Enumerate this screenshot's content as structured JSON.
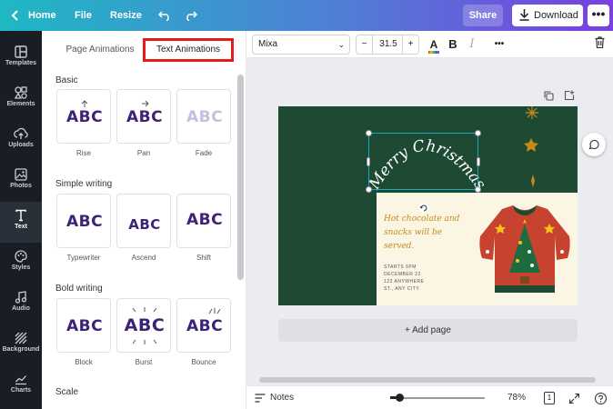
{
  "topbar": {
    "home_label": "Home",
    "file_label": "File",
    "resize_label": "Resize",
    "share_label": "Share",
    "download_label": "Download",
    "more_label": "•••"
  },
  "rail": {
    "items": [
      {
        "label": "Templates",
        "icon": "layout-icon"
      },
      {
        "label": "Elements",
        "icon": "shapes-icon"
      },
      {
        "label": "Uploads",
        "icon": "cloud-upload-icon"
      },
      {
        "label": "Photos",
        "icon": "image-icon"
      },
      {
        "label": "Text",
        "icon": "text-icon"
      },
      {
        "label": "Styles",
        "icon": "palette-icon"
      },
      {
        "label": "Audio",
        "icon": "music-note-icon"
      },
      {
        "label": "Background",
        "icon": "pattern-icon"
      },
      {
        "label": "Charts",
        "icon": "chart-line-icon"
      }
    ],
    "active": "Text"
  },
  "panel": {
    "tabs": {
      "page": "Page Animations",
      "text": "Text Animations"
    },
    "sections": {
      "basic": "Basic",
      "simple": "Simple writing",
      "bold": "Bold writing",
      "scale": "Scale"
    },
    "sample_text": "ABC",
    "cards": {
      "rise": "Rise",
      "pan": "Pan",
      "fade": "Fade",
      "typewriter": "Typewriter",
      "ascend": "Ascend",
      "shift": "Shift",
      "block": "Block",
      "burst": "Burst",
      "bounce": "Bounce"
    }
  },
  "toolbar": {
    "font": "Mixa",
    "font_size": "31.5",
    "minus_label": "−",
    "plus_label": "+",
    "color_label": "A",
    "bold_label": "B",
    "italic_label": "I",
    "more_label": "•••"
  },
  "design": {
    "headline": "Merry Christmas",
    "card_text": "Hot chocolate and snacks will be served.",
    "details": [
      "STARTS 6PM",
      "DECEMBER 22",
      "123 ANYWHERE",
      "ST., ANY CITY"
    ],
    "colors": {
      "background": "#1e4a34",
      "card": "#fbf5e3",
      "accent": "#c98a1a",
      "sweater": "#c7432f"
    }
  },
  "workspace": {
    "add_page_label": "+ Add page"
  },
  "bottombar": {
    "notes_label": "Notes",
    "zoom_level": "78%",
    "page_count": "1",
    "zoom_fraction": 0.1
  }
}
